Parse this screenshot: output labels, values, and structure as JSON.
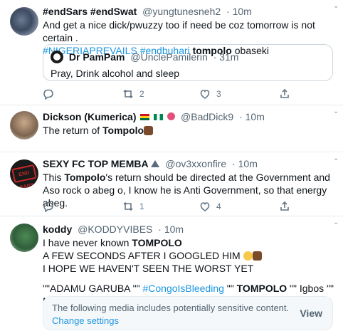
{
  "tweets": [
    {
      "name": "#endSars #endSwat",
      "handle": "@yungtunesneh2",
      "time": "· 10m",
      "text_line1": "And get a nice dick/pwuzzy too if need be coz tomorrow is not certain .",
      "tag1": "#NIGERIAPREVAILS",
      "tag2": "#endbuhari",
      "bold": "tompolo",
      "tail": "obaseki",
      "quote": {
        "name": "Dr PamPam",
        "handle": "@UnclePamilerin",
        "time": "· 31m",
        "text": "Pray, Drink alcohol and sleep"
      },
      "actions": {
        "reply": "",
        "retweet": "2",
        "like": "3"
      }
    },
    {
      "name": "Dickson (Kumerica)",
      "handle": "@BadDick9",
      "time": "· 10m",
      "text_prefix": "The return of",
      "bold": "Tompolo"
    },
    {
      "name": "SEXY FC TOP MEMBA",
      "handle": "@ov3xxonfire",
      "time": "· 10m",
      "avatar_text": "END SARS",
      "text_prefix": "This",
      "bold": "Tompolo",
      "text_rest": "'s return should be directed at the Government and Aso rock o abeg o, I know he is Anti Government, so that energy abeg.",
      "actions": {
        "reply": "",
        "retweet": "1",
        "like": "4"
      }
    },
    {
      "name": "koddy",
      "handle": "@KODDYVIBES",
      "time": "· 10m",
      "line1_prefix": "I have never known",
      "line1_bold": "TOMPOLO",
      "line2": "A FEW SECONDS AFTER I GOOGLED HIM",
      "line3": "I HOPE WE HAVEN'T SEEN THE WORST YET",
      "line4_a": "\"\"ADAMU GARUBA \"\"",
      "line4_tag": "#CongoIsBleeding",
      "line4_b": "\"\"",
      "line4_bold": "TOMPOLO",
      "line4_c": "\"\" Igbos \"\" Mr vp",
      "media_warning": {
        "message": "The following media includes potentially sensitive content.",
        "link": "Change settings",
        "view": "View"
      }
    }
  ],
  "icons": {
    "reply": "reply-icon",
    "retweet": "retweet-icon",
    "like": "like-icon",
    "share": "share-icon",
    "more": "chevron-down-icon"
  },
  "colors": {
    "link": "#1b95e0",
    "muted": "#536471",
    "border": "#e6ecf0"
  }
}
